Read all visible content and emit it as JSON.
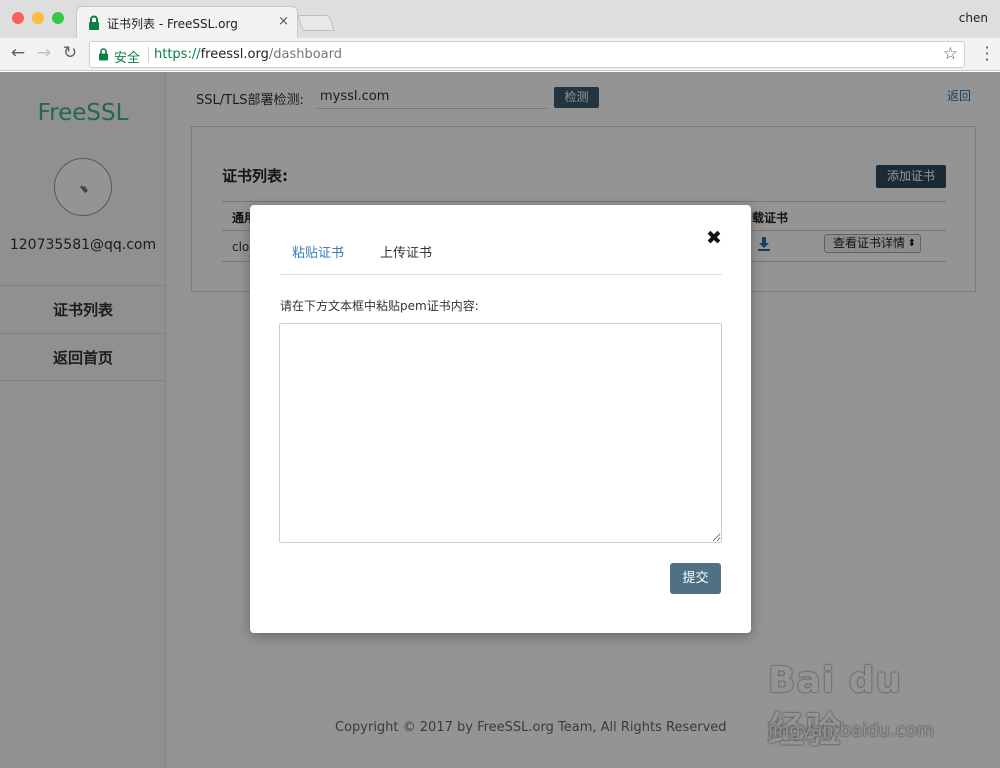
{
  "browser": {
    "tab_title": "证书列表 - FreeSSL.org",
    "tab_close": "×",
    "profile_name": "chen",
    "secure_label": "安全",
    "url_scheme": "https://",
    "url_host": "freessl.org",
    "url_path": "/dashboard",
    "secure_color": "#0b8043"
  },
  "sidebar": {
    "brand": "FreeSSL",
    "brand_color": "#3fb37f",
    "email": "120735581@qq.com",
    "items": [
      {
        "label": "证书列表"
      },
      {
        "label": "返回首页"
      }
    ]
  },
  "header": {
    "detect_label": "SSL/TLS部署检测:",
    "detect_value": "myssl.com",
    "detect_button": "检测",
    "back_link": "返回"
  },
  "panel": {
    "title": "证书列表:",
    "add_button": "添加证书",
    "columns": [
      "通用",
      "载证书"
    ],
    "row": {
      "common_name": "clou",
      "details_select": "查看证书详情"
    }
  },
  "footer": "Copyright © 2017 by FreeSSL.org Team, All Rights Reserved",
  "watermark": {
    "logo": "Bai du 经验",
    "url": "jingyan.baidu.com"
  },
  "modal": {
    "close": "✖",
    "tabs": [
      {
        "label": "粘贴证书",
        "active": true
      },
      {
        "label": "上传证书",
        "active": false
      }
    ],
    "instruction": "请在下方文本框中粘贴pem证书内容:",
    "textarea_value": "",
    "submit": "提交",
    "accent_color": "#3a7ab8"
  }
}
